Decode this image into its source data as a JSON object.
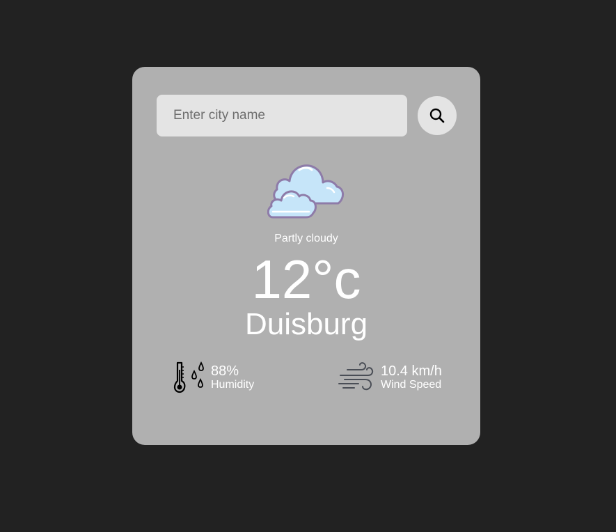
{
  "search": {
    "placeholder": "Enter city name",
    "value": "",
    "button_icon": "search-icon"
  },
  "weather": {
    "icon": "partly-cloudy-icon",
    "condition": "Partly cloudy",
    "temperature": "12°c",
    "city": "Duisburg"
  },
  "details": {
    "humidity": {
      "icon": "humidity-icon",
      "value": "88%",
      "label": "Humidity"
    },
    "wind": {
      "icon": "wind-icon",
      "value": "10.4 km/h",
      "label": "Wind Speed"
    }
  },
  "colors": {
    "page_background": "#222222",
    "card_background": "#b0b0b0",
    "input_background": "#e4e4e4",
    "text": "#ffffff",
    "cloud_fill": "#c6e5f9",
    "cloud_outline": "#8e7ba8"
  }
}
